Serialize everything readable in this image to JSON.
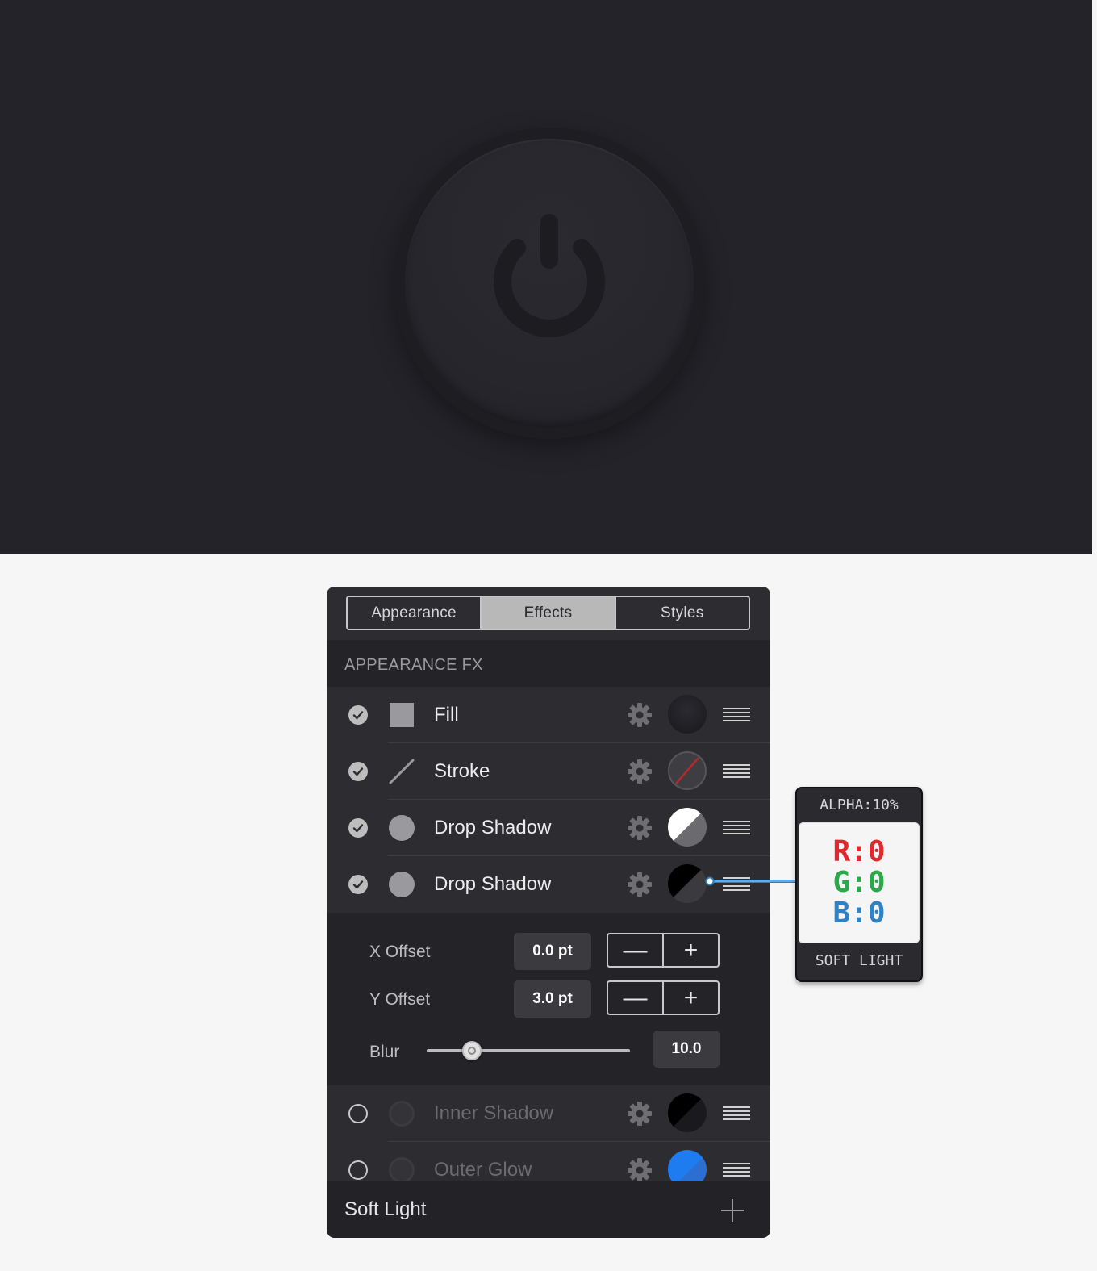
{
  "tabs": [
    {
      "label": "Appearance",
      "active": false
    },
    {
      "label": "Effects",
      "active": true
    },
    {
      "label": "Styles",
      "active": false
    }
  ],
  "section_title": "APPEARANCE FX",
  "rows": [
    {
      "label": "Fill",
      "enabled": true,
      "icon": "square-fill-icon",
      "swatch_color": "#1f1f24"
    },
    {
      "label": "Stroke",
      "enabled": true,
      "icon": "stroke-line-icon",
      "swatch_color": "#3a3a3f"
    },
    {
      "label": "Drop Shadow",
      "enabled": true,
      "icon": "circle-shadow-icon",
      "swatch_color": "#ffffff"
    },
    {
      "label": "Drop Shadow",
      "enabled": true,
      "icon": "circle-shadow-icon",
      "swatch_color": "#000000"
    },
    {
      "label": "Inner Shadow",
      "enabled": false,
      "icon": "circle-shadow-icon",
      "swatch_color": "#000000"
    },
    {
      "label": "Outer Glow",
      "enabled": false,
      "icon": "circle-shadow-icon",
      "swatch_color": "#1e7cf0"
    }
  ],
  "details": {
    "x_offset_label": "X Offset",
    "x_offset_value": "0.0 pt",
    "y_offset_label": "Y Offset",
    "y_offset_value": "3.0 pt",
    "blur_label": "Blur",
    "blur_value": "10.0",
    "minus": "—",
    "plus": "+"
  },
  "footer": {
    "label": "Soft Light"
  },
  "callout": {
    "alpha": "ALPHA:10%",
    "r": "R:0",
    "g": "G:0",
    "b": "B:0",
    "blend": "SOFT LIGHT"
  }
}
